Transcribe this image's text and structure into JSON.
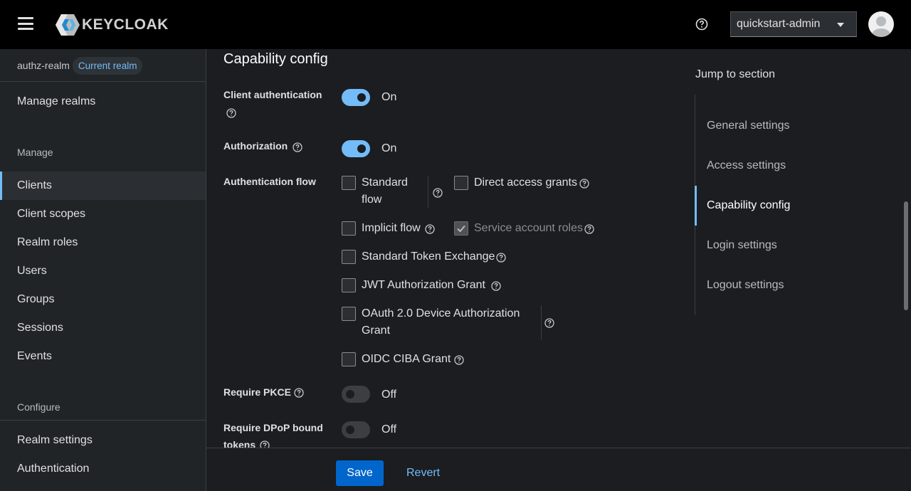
{
  "header": {
    "logo_text": "KEYCLOAK",
    "user_menu": "quickstart-admin"
  },
  "sidebar": {
    "realm_name": "authz-realm",
    "realm_badge": "Current realm",
    "manage_realms": "Manage realms",
    "manage_group": "Manage",
    "manage_items": [
      "Clients",
      "Client scopes",
      "Realm roles",
      "Users",
      "Groups",
      "Sessions",
      "Events"
    ],
    "configure_group": "Configure",
    "configure_items": [
      "Realm settings",
      "Authentication"
    ],
    "active_item": "Clients"
  },
  "main": {
    "section_title": "Capability config",
    "client_auth": {
      "label": "Client authentication",
      "state": "On",
      "on": true
    },
    "authorization": {
      "label": "Authorization",
      "state": "On",
      "on": true
    },
    "auth_flow": {
      "label": "Authentication flow",
      "options": {
        "standard_flow_1": "Standard",
        "standard_flow_2": "flow",
        "direct_access": "Direct access grants",
        "implicit": "Implicit flow",
        "service_account": "Service account roles",
        "token_exchange": "Standard Token Exchange",
        "jwt_grant": "JWT Authorization Grant",
        "device_grant_1": "OAuth 2.0 Device Authorization",
        "device_grant_2": "Grant",
        "ciba": "OIDC CIBA Grant"
      }
    },
    "pkce": {
      "label": "Require PKCE",
      "state": "Off",
      "on": false
    },
    "dpop": {
      "label_1": "Require DPoP bound",
      "label_2": "tokens",
      "state": "Off",
      "on": false
    }
  },
  "jump": {
    "title": "Jump to section",
    "items": [
      "General settings",
      "Access settings",
      "Capability config",
      "Login settings",
      "Logout settings"
    ],
    "active": "Capability config"
  },
  "footer": {
    "save": "Save",
    "revert": "Revert"
  },
  "colors": {
    "accent": "#73bcf7",
    "primary_button": "#0066cc"
  }
}
